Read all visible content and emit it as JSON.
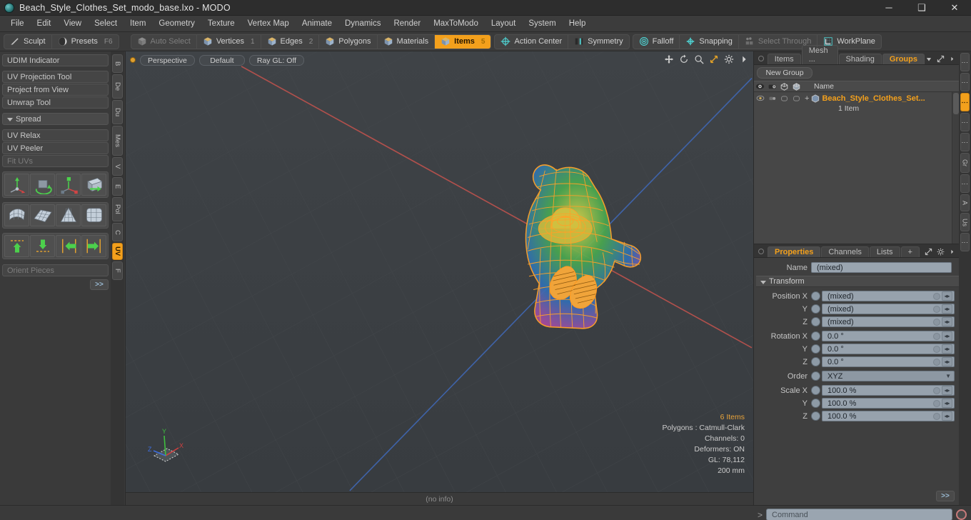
{
  "window": {
    "title": "Beach_Style_Clothes_Set_modo_base.lxo - MODO",
    "minimize": "─",
    "maximize": "❑",
    "close": "✕"
  },
  "menubar": {
    "items": [
      "File",
      "Edit",
      "View",
      "Select",
      "Item",
      "Geometry",
      "Texture",
      "Vertex Map",
      "Animate",
      "Dynamics",
      "Render",
      "MaxToModo",
      "Layout",
      "System",
      "Help"
    ]
  },
  "modebar": {
    "group1": [
      {
        "label": "Sculpt",
        "icon": "pencil-icon",
        "num": "",
        "state": "normal"
      },
      {
        "label": "Presets",
        "icon": "sphere-icon",
        "num": "F6",
        "state": "normal"
      }
    ],
    "group2": [
      {
        "label": "Auto Select",
        "icon": "cube-gray-icon",
        "num": "",
        "state": "dim"
      },
      {
        "label": "Vertices",
        "icon": "cube-icon",
        "num": "1",
        "state": "normal"
      },
      {
        "label": "Edges",
        "icon": "cube-icon",
        "num": "2",
        "state": "normal"
      },
      {
        "label": "Polygons",
        "icon": "cube-icon",
        "num": "",
        "state": "normal"
      },
      {
        "label": "Materials",
        "icon": "cube-icon",
        "num": "",
        "state": "normal"
      },
      {
        "label": "Items",
        "icon": "cube-icon",
        "num": "5",
        "state": "active"
      }
    ],
    "group3": [
      {
        "label": "Action Center",
        "icon": "crosshair-circle-icon",
        "num": "",
        "state": "normal"
      },
      {
        "label": "Symmetry",
        "icon": "symmetry-icon",
        "num": "",
        "state": "normal"
      }
    ],
    "group4": [
      {
        "label": "Falloff",
        "icon": "target-icon",
        "num": "",
        "state": "normal"
      },
      {
        "label": "Snapping",
        "icon": "snap-icon",
        "num": "",
        "state": "normal"
      },
      {
        "label": "Select Through",
        "icon": "select-through-icon",
        "num": "",
        "state": "dim"
      },
      {
        "label": "WorkPlane",
        "icon": "workplane-icon",
        "num": "",
        "state": "normal"
      }
    ]
  },
  "left_panel": {
    "rows": [
      {
        "label": "UDIM Indicator",
        "style": "normal",
        "gap": false
      },
      {
        "label": "UV Projection Tool",
        "style": "normal",
        "gap": true
      },
      {
        "label": "Project from View",
        "style": "normal",
        "gap": false
      },
      {
        "label": "Unwrap Tool",
        "style": "normal",
        "gap": false
      },
      {
        "label": "Spread",
        "style": "section",
        "gap": true
      },
      {
        "label": "UV Relax",
        "style": "normal",
        "gap": true
      },
      {
        "label": "UV Peeler",
        "style": "normal",
        "gap": false
      },
      {
        "label": "Fit UVs",
        "style": "dim",
        "gap": false
      }
    ],
    "icon_rows": [
      [
        "move-axis-icon",
        "rotate-icon",
        "scale-axis-icon",
        "flip-icon"
      ],
      [
        "mesh-bend-icon",
        "mesh-grid-icon",
        "mesh-cone-icon",
        "mesh-sphere-icon"
      ],
      [
        "align-up-icon",
        "align-down-icon",
        "align-left-icon",
        "align-right-icon"
      ]
    ],
    "orient_pieces": "Orient Pieces",
    "more_button": ">>",
    "tabs": [
      {
        "label": "B",
        "on": false
      },
      {
        "label": "De",
        "on": false
      },
      {
        "label": "Du",
        "on": false
      },
      {
        "label": "Mes",
        "on": false
      },
      {
        "label": "V",
        "on": false
      },
      {
        "label": "E",
        "on": false
      },
      {
        "label": "Pol",
        "on": false
      },
      {
        "label": "C",
        "on": false
      },
      {
        "label": "UV",
        "on": true
      },
      {
        "label": "F",
        "on": false
      }
    ]
  },
  "viewport": {
    "buttons": [
      "Perspective",
      "Default",
      "Ray GL: Off"
    ],
    "tool_icons": [
      "move-tool-icon",
      "rotate-tool-icon",
      "zoom-tool-icon",
      "fit-tool-icon",
      "gear-icon",
      "chevron-right-icon"
    ],
    "stats": [
      {
        "text": "6 Items",
        "highlight": true
      },
      {
        "text": "Polygons : Catmull-Clark",
        "highlight": false
      },
      {
        "text": "Channels: 0",
        "highlight": false
      },
      {
        "text": "Deformers: ON",
        "highlight": false
      },
      {
        "text": "GL: 78,112",
        "highlight": false
      },
      {
        "text": "200 mm",
        "highlight": false
      }
    ],
    "gizmo_axes": [
      "X",
      "Y",
      "Z"
    ],
    "footer": "(no info)"
  },
  "right_top": {
    "tabs": [
      {
        "label": "Items",
        "on": false
      },
      {
        "label": "Mesh ...",
        "on": false
      },
      {
        "label": "Shading",
        "on": false
      },
      {
        "label": "Groups",
        "on": true
      }
    ],
    "dropdown_icon": "chevron-down-icon",
    "expand_icon": "expand-icon",
    "more_icon": "chevron-right-icon",
    "new_group_button": "New Group",
    "columns": [
      "eye-icon",
      "camera-icon",
      "cube-outline-icon",
      "cube-solid-icon",
      "Name"
    ],
    "rows": [
      {
        "expander": "+",
        "icon": "group-cube-icon",
        "name": "Beach_Style_Clothes_Set...",
        "sub": "1 Item"
      }
    ]
  },
  "properties": {
    "tabs": [
      {
        "label": "Properties",
        "on": true
      },
      {
        "label": "Channels",
        "on": false
      },
      {
        "label": "Lists",
        "on": false
      },
      {
        "label": "+",
        "on": false
      }
    ],
    "expand_icon": "expand-icon",
    "gear_icon": "gear-icon",
    "more_icon": "chevron-right-icon",
    "name_label": "Name",
    "name_value": "(mixed)",
    "transform_header": "Transform",
    "fields": [
      {
        "label": "Position X",
        "value": "(mixed)",
        "type": "num"
      },
      {
        "label": "Y",
        "value": "(mixed)",
        "type": "num"
      },
      {
        "label": "Z",
        "value": "(mixed)",
        "type": "num"
      },
      {
        "label": "Rotation X",
        "value": "0.0 °",
        "type": "num"
      },
      {
        "label": "Y",
        "value": "0.0 °",
        "type": "num"
      },
      {
        "label": "Z",
        "value": "0.0 °",
        "type": "num"
      },
      {
        "label": "Order",
        "value": "XYZ",
        "type": "select"
      },
      {
        "label": "Scale X",
        "value": "100.0 %",
        "type": "num"
      },
      {
        "label": "Y",
        "value": "100.0 %",
        "type": "num"
      },
      {
        "label": "Z",
        "value": "100.0 %",
        "type": "num"
      }
    ],
    "more_button": ">>",
    "side_tabs": [
      {
        "label": "⋮",
        "on": false
      },
      {
        "label": "⋮",
        "on": false
      },
      {
        "label": "⋮",
        "on": true
      },
      {
        "label": "⋮",
        "on": false
      },
      {
        "label": "⋮",
        "on": false
      },
      {
        "label": "Gr",
        "on": false
      },
      {
        "label": "⋮",
        "on": false
      },
      {
        "label": "A",
        "on": false
      },
      {
        "label": "Us",
        "on": false
      },
      {
        "label": "⋮",
        "on": false
      }
    ]
  },
  "bottom": {
    "command_prompt": ">",
    "command_placeholder": "Command",
    "record_icon": "record-icon"
  },
  "colors": {
    "accent": "#f3a01c",
    "window_bg": "#3a3a3a",
    "viewport_bg": "#3c4044",
    "field_bg": "#9aa5b0",
    "x_axis": "#c0504d",
    "y_axis": "#4f81bd",
    "wireframe": "#ffa128"
  }
}
